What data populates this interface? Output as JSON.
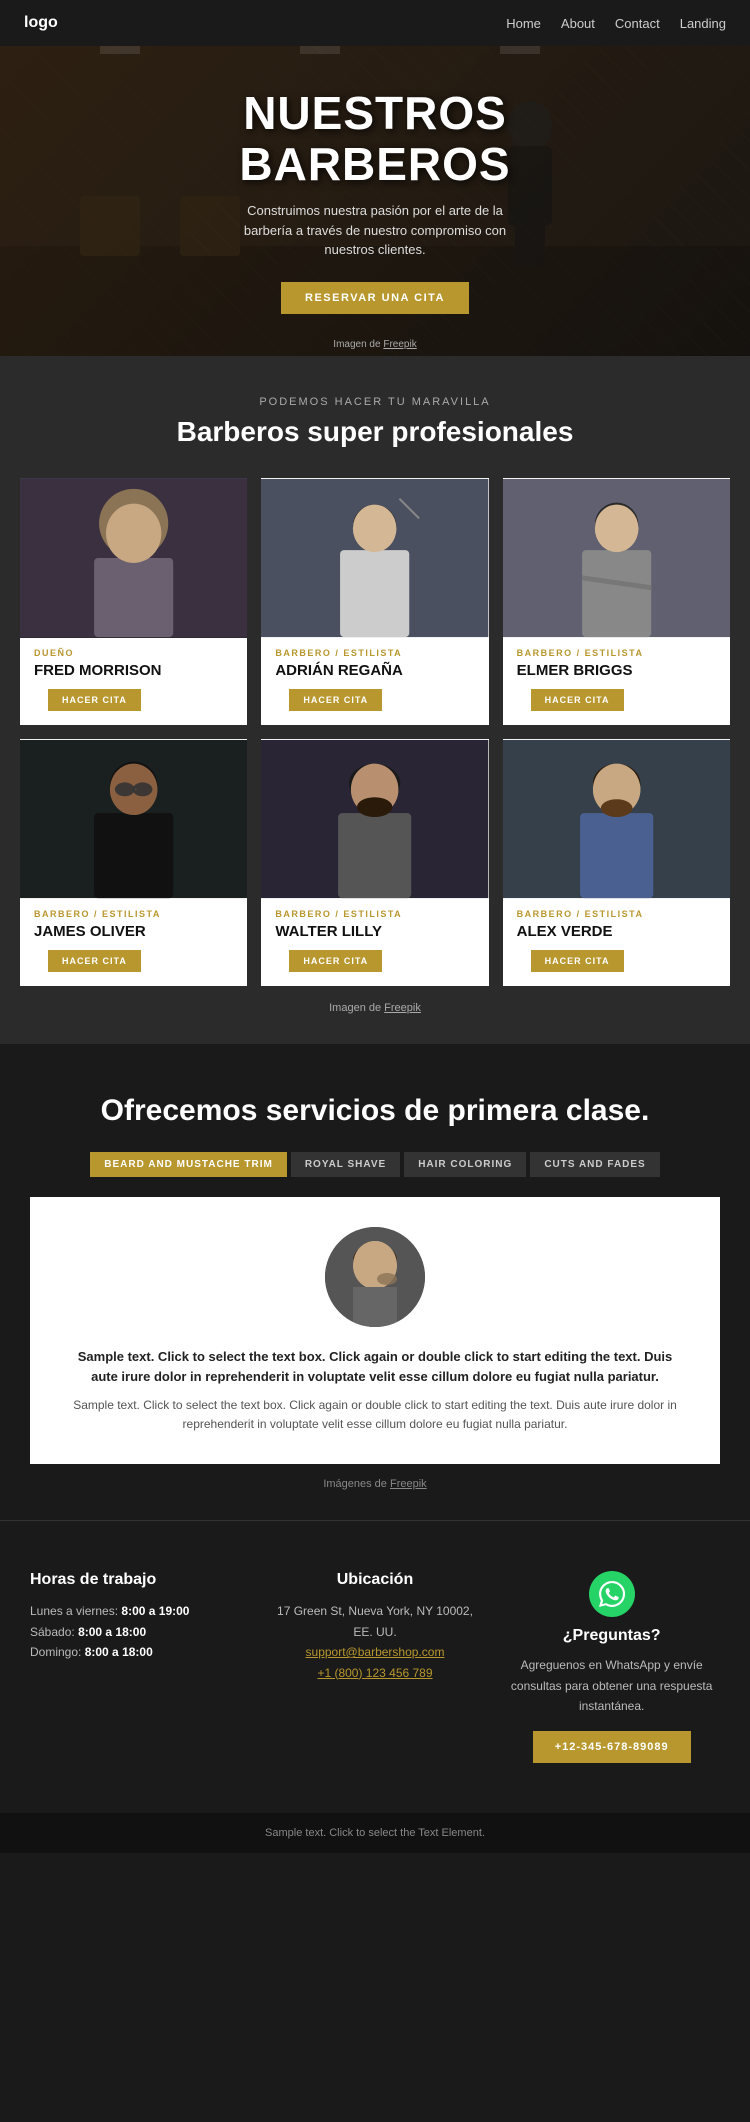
{
  "nav": {
    "logo": "logo",
    "links": [
      {
        "label": "Home",
        "href": "#"
      },
      {
        "label": "About",
        "href": "#"
      },
      {
        "label": "Contact",
        "href": "#"
      },
      {
        "label": "Landing",
        "href": "#"
      }
    ]
  },
  "hero": {
    "title_line1": "NUESTROS",
    "title_line2": "BARBEROS",
    "subtitle": "Construimos nuestra pasión por el arte de la barbería a través de nuestro compromiso con nuestros clientes.",
    "cta_label": "RESERVAR UNA CITA",
    "credit_text": "Imagen de",
    "credit_link": "Freepik"
  },
  "barbers_section": {
    "label": "PODEMOS HACER TU MARAVILLA",
    "title": "Barberos super profesionales",
    "credit_text": "Imagen de",
    "credit_link": "Freepik",
    "barbers": [
      {
        "role": "DUEÑO",
        "name": "FRED MORRISON",
        "btn_label": "HACER CITA",
        "color": "#3a3a4a"
      },
      {
        "role": "BARBERO / ESTILISTA",
        "name": "ADRIÁN REGAÑA",
        "btn_label": "HACER CITA",
        "color": "#4a4a5a"
      },
      {
        "role": "BARBERO / ESTILISTA",
        "name": "ELMER BRIGGS",
        "btn_label": "HACER CITA",
        "color": "#5a5a6a"
      },
      {
        "role": "BARBERO / ESTILISTA",
        "name": "JAMES OLIVER",
        "btn_label": "HACER CITA",
        "color": "#2a2a2a"
      },
      {
        "role": "BARBERO / ESTILISTA",
        "name": "WALTER LILLY",
        "btn_label": "HACER CITA",
        "color": "#3a3040"
      },
      {
        "role": "BARBERO / ESTILISTA",
        "name": "ALEX VERDE",
        "btn_label": "HACER CITA",
        "color": "#40454a"
      }
    ]
  },
  "services_section": {
    "title": "Ofrecemos servicios de primera clase.",
    "tabs": [
      {
        "label": "BEARD AND MUSTACHE TRIM",
        "active": true
      },
      {
        "label": "ROYAL SHAVE",
        "active": false
      },
      {
        "label": "HAIR COLORING",
        "active": false
      },
      {
        "label": "CUTS AND FADES",
        "active": false
      }
    ],
    "service_text_bold": "Sample text. Click to select the text box. Click again or double click to start editing the text. Duis aute irure dolor in reprehenderit in voluptate velit esse cillum dolore eu fugiat nulla pariatur.",
    "service_text": "Sample text. Click to select the text box. Click again or double click to start editing the text. Duis aute irure dolor in reprehenderit in voluptate velit esse cillum dolore eu fugiat nulla pariatur.",
    "credit_text": "Imágenes de",
    "credit_link": "Freepik"
  },
  "footer": {
    "hours": {
      "title": "Horas de trabajo",
      "mon_fri_label": "Lunes a viernes:",
      "mon_fri_hours": "8:00 a 19:00",
      "sat_label": "Sábado:",
      "sat_hours": "8:00 a 18:00",
      "sun_label": "Domingo:",
      "sun_hours": "8:00 a 18:00"
    },
    "location": {
      "title": "Ubicación",
      "address": "17 Green St, Nueva York, NY 10002, EE. UU.",
      "email": "support@barbershop.com",
      "phone": "+1 (800) 123 456 789"
    },
    "contact": {
      "icon": "📞",
      "title": "¿Preguntas?",
      "text": "Agreguenos en WhatsApp y envíe consultas para obtener una respuesta instantánea.",
      "btn_label": "+12-345-678-89089"
    }
  },
  "bottom_bar": {
    "text": "Sample text. Click to select the Text Element."
  }
}
